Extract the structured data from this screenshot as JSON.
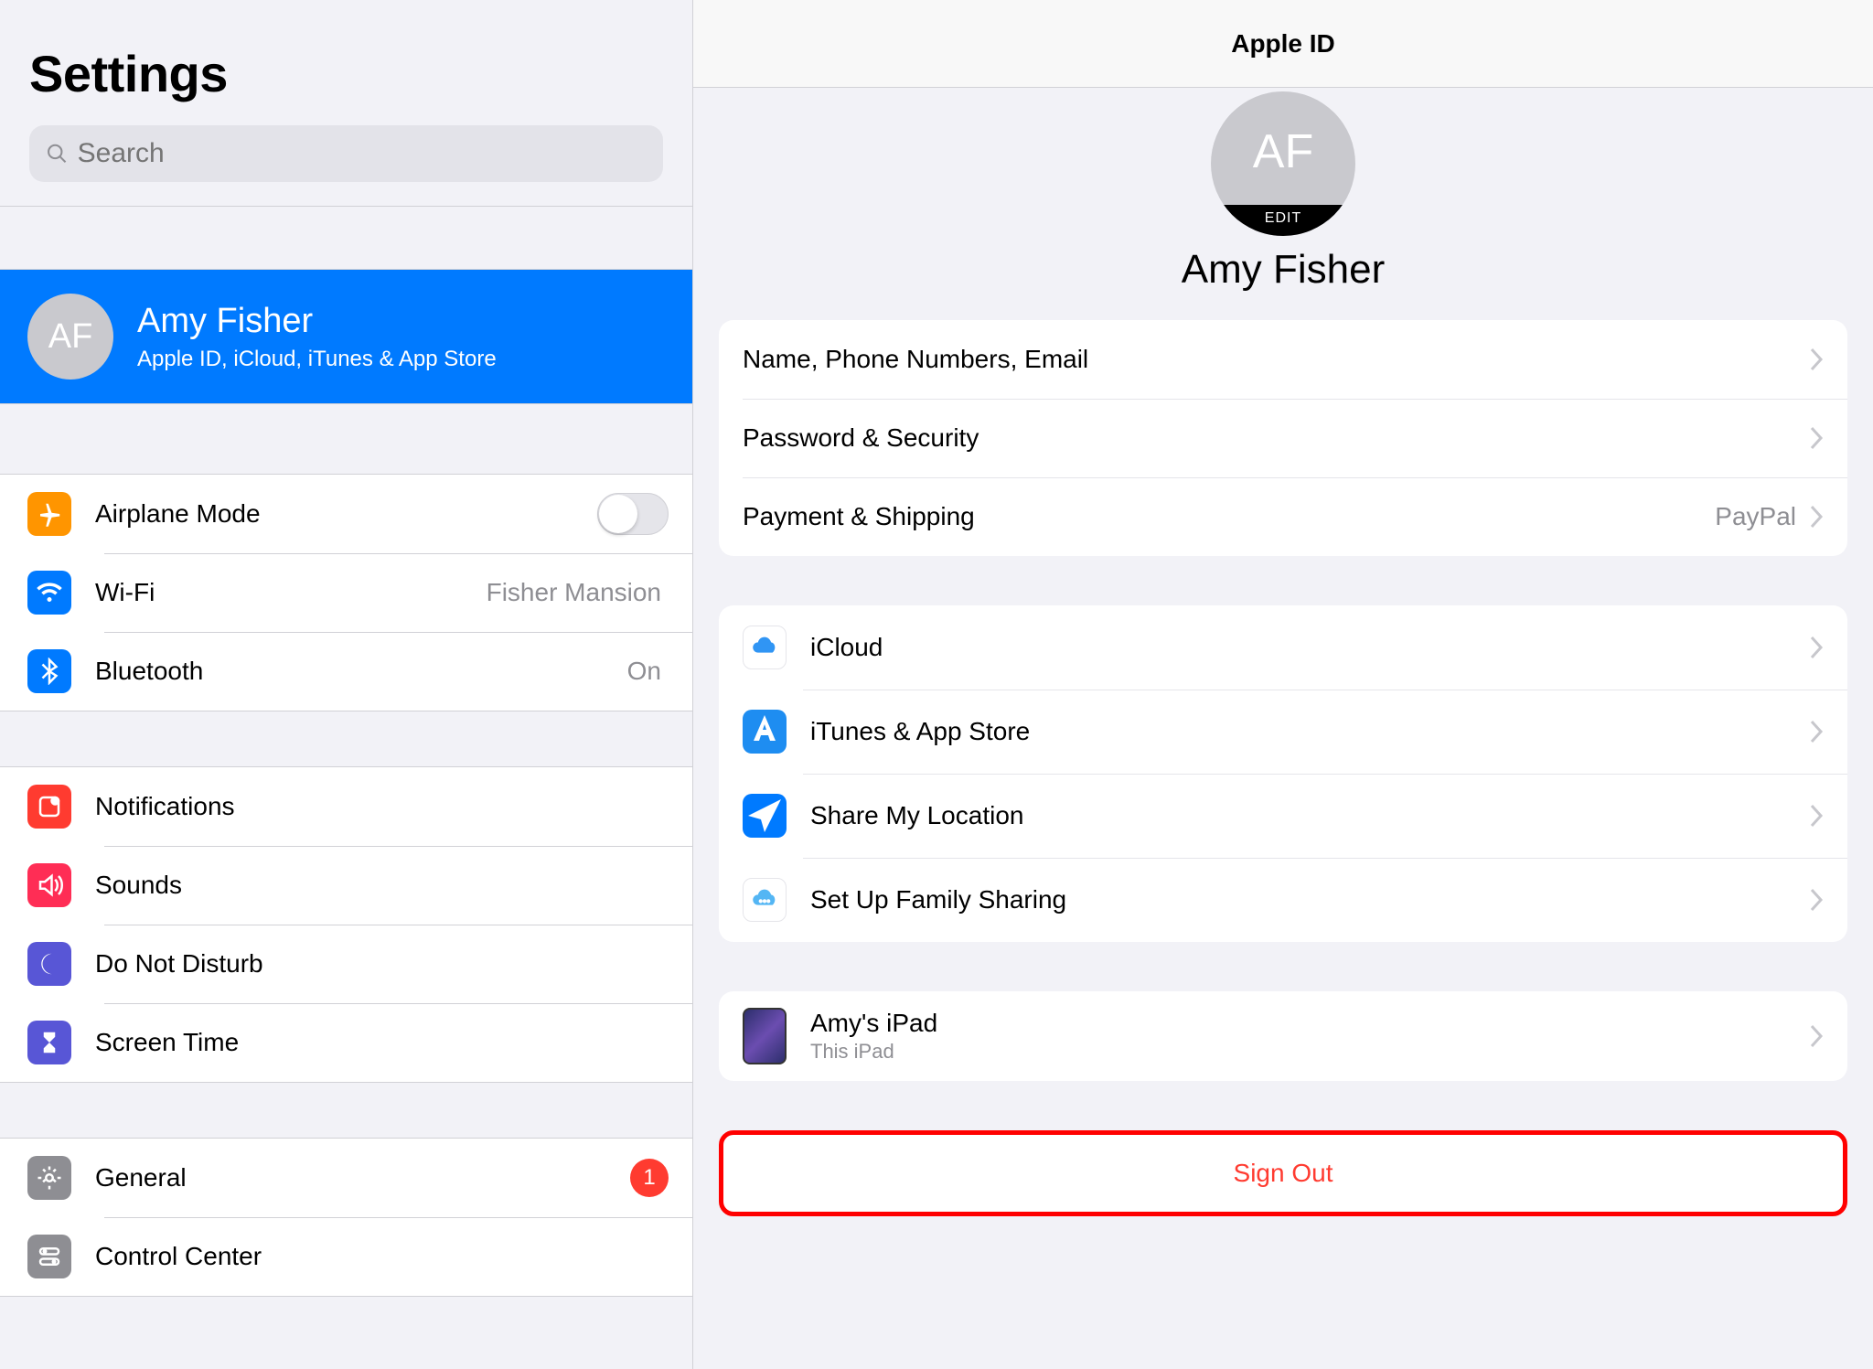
{
  "sidebar": {
    "title": "Settings",
    "search_placeholder": "Search",
    "profile": {
      "initials": "AF",
      "name": "Amy Fisher",
      "subtitle": "Apple ID, iCloud, iTunes & App Store"
    },
    "group1": [
      {
        "label": "Airplane Mode",
        "icon": "airplane",
        "color": "#ff9500",
        "control": "switch"
      },
      {
        "label": "Wi-Fi",
        "icon": "wifi",
        "color": "#007aff",
        "value": "Fisher Mansion"
      },
      {
        "label": "Bluetooth",
        "icon": "bluetooth",
        "color": "#007aff",
        "value": "On"
      }
    ],
    "group2": [
      {
        "label": "Notifications",
        "icon": "notifications",
        "color": "#ff3b30"
      },
      {
        "label": "Sounds",
        "icon": "sounds",
        "color": "#ff2d55"
      },
      {
        "label": "Do Not Disturb",
        "icon": "dnd",
        "color": "#5856d6"
      },
      {
        "label": "Screen Time",
        "icon": "screentime",
        "color": "#5856d6"
      }
    ],
    "group3": [
      {
        "label": "General",
        "icon": "general",
        "color": "#8e8e93",
        "badge": "1"
      },
      {
        "label": "Control Center",
        "icon": "controlcenter",
        "color": "#8e8e93"
      }
    ]
  },
  "detail": {
    "header_title": "Apple ID",
    "avatar": {
      "initials": "AF",
      "edit_label": "EDIT"
    },
    "name": "Amy Fisher",
    "section1": [
      {
        "label": "Name, Phone Numbers, Email"
      },
      {
        "label": "Password & Security"
      },
      {
        "label": "Payment & Shipping",
        "value": "PayPal"
      }
    ],
    "section2": [
      {
        "label": "iCloud",
        "icon": "icloud"
      },
      {
        "label": "iTunes & App Store",
        "icon": "appstore"
      },
      {
        "label": "Share My Location",
        "icon": "location"
      },
      {
        "label": "Set Up Family Sharing",
        "icon": "family"
      }
    ],
    "device": {
      "name": "Amy's iPad",
      "subtitle": "This iPad"
    },
    "signout": "Sign Out"
  }
}
